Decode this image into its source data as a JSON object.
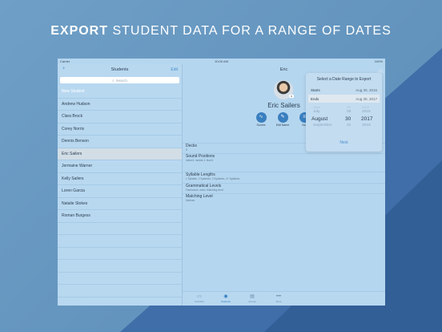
{
  "headline": {
    "bold": "EXPORT",
    "rest": " STUDENT DATA FOR A RANGE OF DATES"
  },
  "statusbar": {
    "carrier": "Carrier",
    "time": "10:00 AM",
    "battery": "100%"
  },
  "students_pane": {
    "title": "Students",
    "edit_label": "Edit",
    "add_icon": "plus-icon",
    "search_placeholder": "Search",
    "items": [
      {
        "label": "New Student",
        "style": "new"
      },
      {
        "label": "Andrew Hudson"
      },
      {
        "label": "Clara Brock"
      },
      {
        "label": "Corey Norris"
      },
      {
        "label": "Dennis Benson"
      },
      {
        "label": "Eric Sailers",
        "selected": true
      },
      {
        "label": "Jermaine Warner"
      },
      {
        "label": "Kelly Sailers"
      },
      {
        "label": "Loren Garcia"
      },
      {
        "label": "Natalie Stokes"
      },
      {
        "label": "Roman Burgess"
      }
    ]
  },
  "detail": {
    "header": "Eric",
    "name": "Eric Sailers",
    "actions": [
      {
        "label": "Scores",
        "icon": "chart-icon"
      },
      {
        "label": "Edit Name",
        "icon": "edit-icon"
      },
      {
        "label": "Not",
        "icon": "notes-icon"
      }
    ],
    "sections": [
      {
        "title": "Decks",
        "sub": "5"
      },
      {
        "title": "Sound Positions",
        "sub": "Initial 6, medial 4, final 6"
      },
      {
        "title": "Syllable Lengths",
        "sub": "1 Syllable, 2 Syllables, 3 Syllables, 4+ Syllables"
      },
      {
        "title": "Grammatical Levels",
        "sub": "Flashcards, word, Matching word"
      },
      {
        "title": "Matching Level",
        "sub": "Medium"
      }
    ]
  },
  "popover": {
    "title": "Select a Date Range to Export",
    "starts_label": "Starts",
    "starts_value": "Aug 30, 2016",
    "ends_label": "Ends",
    "ends_value": "Aug 30, 2017",
    "picker": {
      "above2": [
        "June",
        "28",
        "2015"
      ],
      "above": [
        "July",
        "29",
        "2016"
      ],
      "current": [
        "August",
        "30",
        "2017"
      ],
      "below": [
        "September",
        "31",
        "2018"
      ]
    },
    "next_label": "Next"
  },
  "tabbar": [
    {
      "label": "Activities",
      "icon": "cards-icon"
    },
    {
      "label": "Students",
      "icon": "person-icon",
      "active": true
    },
    {
      "label": "Groups",
      "icon": "group-icon"
    },
    {
      "label": "More",
      "icon": "more-icon"
    }
  ],
  "colors": {
    "accent": "#3a7fbf",
    "background": "#6f9fc6",
    "pane": "#b8d8f0"
  }
}
